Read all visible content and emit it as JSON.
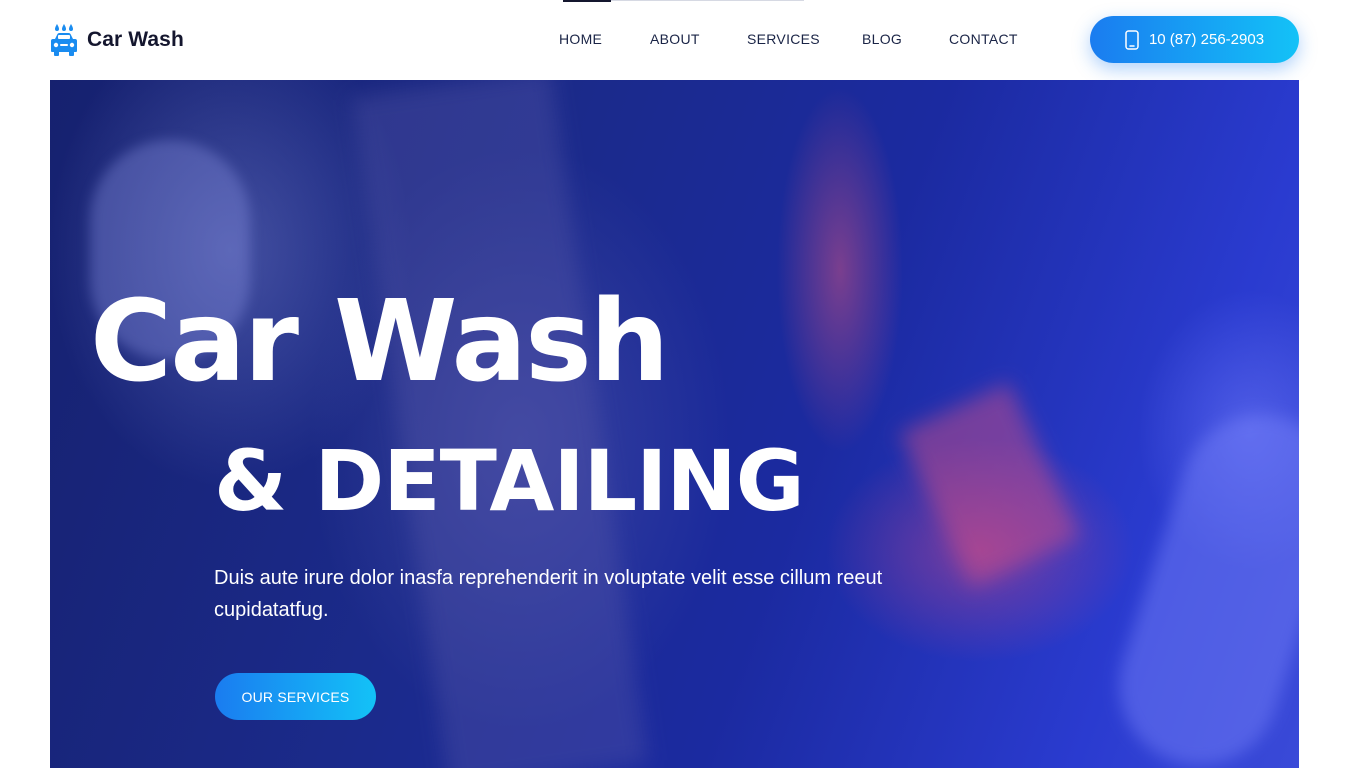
{
  "header": {
    "logo_text": "Car Wash",
    "logo_icon": "car-wash-icon",
    "nav": [
      {
        "label": "HOME",
        "active": true
      },
      {
        "label": "ABOUT"
      },
      {
        "label": "SERVICES"
      },
      {
        "label": "BLOG"
      },
      {
        "label": "CONTACT"
      }
    ],
    "phone": {
      "label": "10 (87) 256-2903",
      "icon": "phone-icon"
    }
  },
  "hero": {
    "title_line1": "Car Wash",
    "title_line2": "& DETAILING",
    "description": "Duis aute irure dolor inasfa reprehenderit in voluptate velit esse cillum reeut cupidatatfug.",
    "cta_label": "OUR SERVICES"
  },
  "colors": {
    "brand_blue": "#1a7cf0",
    "brand_cyan": "#13c2f7",
    "nav_text": "#1a2446",
    "logo_text": "#14162e",
    "hero_overlay": "#1b2a8a"
  }
}
